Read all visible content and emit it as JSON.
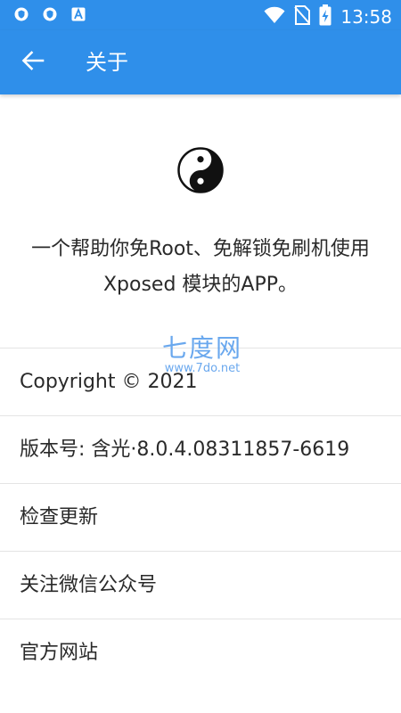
{
  "status_bar": {
    "time": "13:58",
    "icons": [
      "shield-icon",
      "shield-icon",
      "text-a-icon",
      "wifi-icon",
      "no-sim-icon",
      "battery-charging-icon"
    ]
  },
  "app_bar": {
    "title": "关于",
    "back_icon": "arrow-left-icon"
  },
  "header": {
    "logo_icon": "yin-yang-icon",
    "description": "一个帮助你免Root、免解锁免刷机使用 Xposed 模块的APP。"
  },
  "watermark": {
    "title": "七度网",
    "url": "www.7do.net"
  },
  "list": {
    "items": [
      {
        "label": "Copyright © 2021"
      },
      {
        "label": "版本号: 含光·8.0.4.08311857-6619"
      },
      {
        "label": "检查更新"
      },
      {
        "label": "关注微信公众号"
      },
      {
        "label": "官方网站"
      }
    ]
  },
  "colors": {
    "primary": "#2f8fea",
    "text": "#2a2a2a",
    "divider": "#e4e4e4"
  }
}
